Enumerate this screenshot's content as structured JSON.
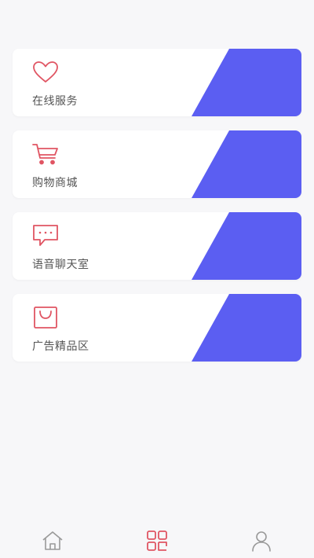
{
  "colors": {
    "accent_blue": "#5b5ef2",
    "icon_red": "#e05563",
    "label_gray": "#555555",
    "tab_inactive": "#999999"
  },
  "menu": {
    "items": [
      {
        "label": "在线服务",
        "icon": "heart-icon"
      },
      {
        "label": "购物商城",
        "icon": "shopping-cart-icon"
      },
      {
        "label": "语音聊天室",
        "icon": "chat-bubble-icon"
      },
      {
        "label": "广告精品区",
        "icon": "shopping-bag-icon"
      }
    ]
  },
  "tabbar": {
    "tabs": [
      {
        "icon": "home-icon",
        "active": false
      },
      {
        "icon": "grid-icon",
        "active": true
      },
      {
        "icon": "user-icon",
        "active": false
      }
    ]
  }
}
